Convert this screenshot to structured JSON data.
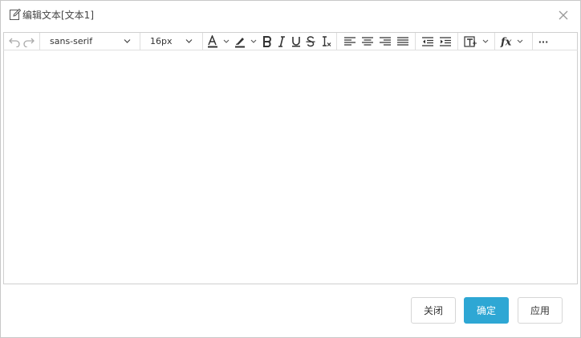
{
  "dialog": {
    "title": "编辑文本[文本1]"
  },
  "toolbar": {
    "font_family": "sans-serif",
    "font_size": "16px",
    "more_label": "···"
  },
  "editor": {
    "content": ""
  },
  "footer": {
    "close_label": "关闭",
    "confirm_label": "确定",
    "apply_label": "应用"
  },
  "colors": {
    "primary": "#2ea7d4",
    "icon": "#333333",
    "disabled_icon": "#aaaaaa"
  }
}
